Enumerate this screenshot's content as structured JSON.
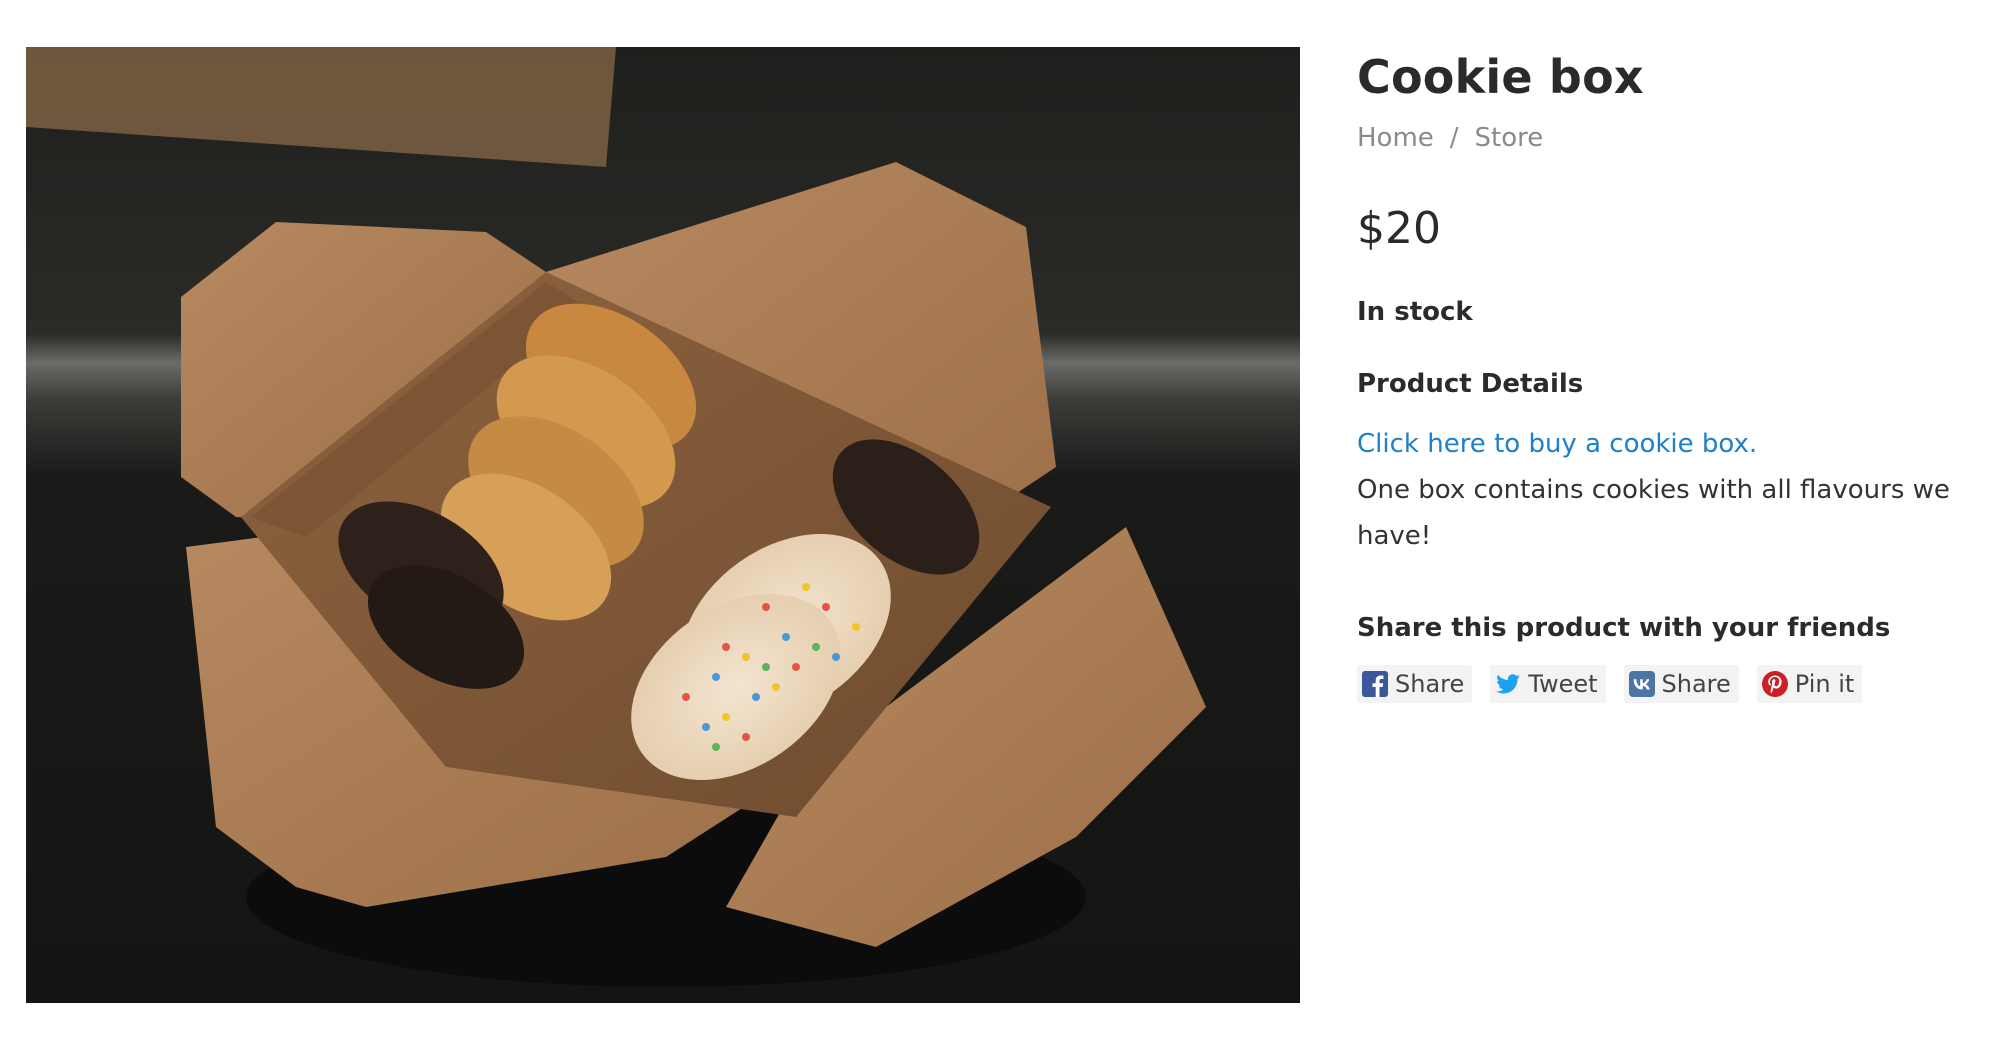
{
  "product": {
    "title": "Cookie box",
    "breadcrumb": {
      "home": "Home",
      "separator": "/",
      "store": "Store"
    },
    "price": "$20",
    "stock_status": "In stock",
    "details_heading": "Product Details",
    "details_link": "Click here to buy a cookie box.",
    "details_text": "One box contains cookies with all flavours we have!"
  },
  "share": {
    "heading": "Share this product with your friends",
    "buttons": [
      {
        "label": "Share",
        "icon": "facebook-icon",
        "color": "#3b5998"
      },
      {
        "label": "Tweet",
        "icon": "twitter-icon",
        "color": "#1da1f2"
      },
      {
        "label": "Share",
        "icon": "vk-icon",
        "color": "#4c75a3"
      },
      {
        "label": "Pin it",
        "icon": "pinterest-icon",
        "color": "#cb2027"
      }
    ]
  },
  "colors": {
    "link": "#1f7fc8",
    "breadcrumb": "#8a8a8a",
    "text": "#2b2b2b"
  }
}
